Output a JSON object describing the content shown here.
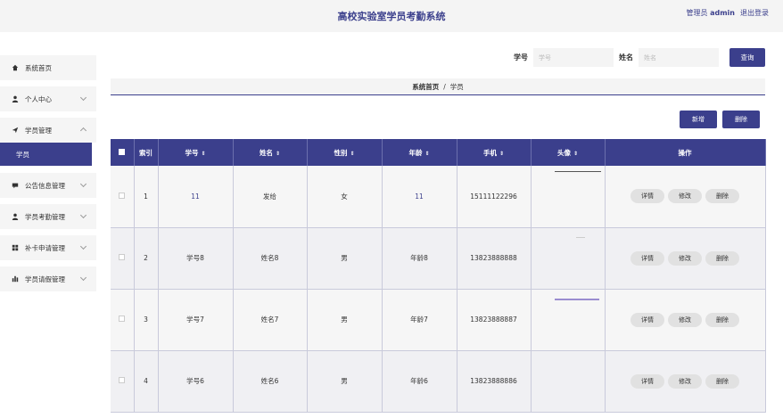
{
  "header": {
    "title": "高校实验室学员考勤系统",
    "role": "管理员",
    "username": "admin",
    "logout": "退出登录"
  },
  "sidebar": {
    "items": [
      {
        "label": "系统首页",
        "icon": "home-icon"
      },
      {
        "label": "个人中心",
        "icon": "user-icon"
      },
      {
        "label": "学员管理",
        "icon": "send-icon"
      },
      {
        "label": "公告信息管理",
        "icon": "chat-icon"
      },
      {
        "label": "学员考勤管理",
        "icon": "user-icon"
      },
      {
        "label": "补卡申请管理",
        "icon": "grid-icon"
      },
      {
        "label": "学员请假管理",
        "icon": "chart-icon"
      }
    ],
    "active_sub": "学员"
  },
  "search": {
    "id_label": "学号",
    "id_placeholder": "学号",
    "name_label": "姓名",
    "name_placeholder": "姓名",
    "button": "查询"
  },
  "breadcrumb": {
    "home": "系统首页",
    "sep": "/",
    "current": "学员"
  },
  "actions": {
    "add": "新增",
    "delete": "删除"
  },
  "table": {
    "headers": [
      "索引",
      "学号",
      "姓名",
      "性别",
      "年龄",
      "手机",
      "头像",
      "操作"
    ],
    "rows": [
      {
        "index": "1",
        "id": "11",
        "name": "发给",
        "gender": "女",
        "age": "11",
        "phone": "15111122296"
      },
      {
        "index": "2",
        "id": "学号8",
        "name": "姓名8",
        "gender": "男",
        "age": "年龄8",
        "phone": "13823888888"
      },
      {
        "index": "3",
        "id": "学号7",
        "name": "姓名7",
        "gender": "男",
        "age": "年龄7",
        "phone": "13823888887"
      },
      {
        "index": "4",
        "id": "学号6",
        "name": "姓名6",
        "gender": "男",
        "age": "年龄6",
        "phone": "13823888886"
      }
    ],
    "row_buttons": {
      "detail": "详情",
      "edit": "修改",
      "delete": "删除"
    }
  },
  "colors": {
    "primary": "#3b3f8c",
    "header_bg": "#f4f4f4",
    "row_button_bg": "#e1e1e1"
  }
}
